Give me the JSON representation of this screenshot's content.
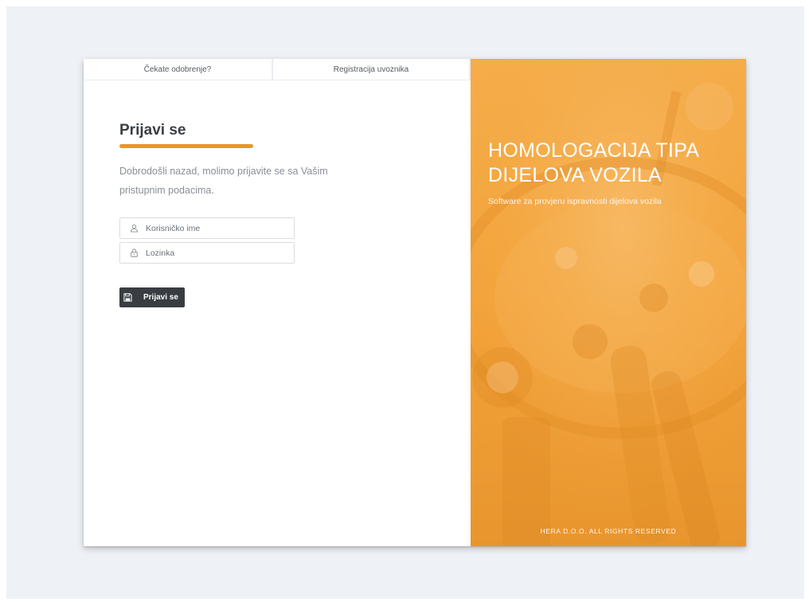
{
  "tabs": [
    {
      "label": "Čekate odobrenje?"
    },
    {
      "label": "Registracija uvoznika"
    }
  ],
  "login": {
    "title": "Prijavi se",
    "subtitle": "Dobrodošli nazad, molimo prijavite se sa Vašim pristupnim podacima.",
    "username_placeholder": "Korisničko ime",
    "password_placeholder": "Lozinka",
    "submit_label": "Prijavi se",
    "accent_color": "#e9952b"
  },
  "hero": {
    "title": "HOMOLOGACIJA TIPA DIJELOVA VOZILA",
    "subtitle": "Software za provjeru ispravnosti dijelova vozila",
    "footer": "HERA D.O.O. ALL RIGHTS RESERVED",
    "overlay_color": "#f3a33a"
  },
  "icons": {
    "username": "user-icon",
    "password": "lock-icon",
    "submit": "save-icon"
  }
}
